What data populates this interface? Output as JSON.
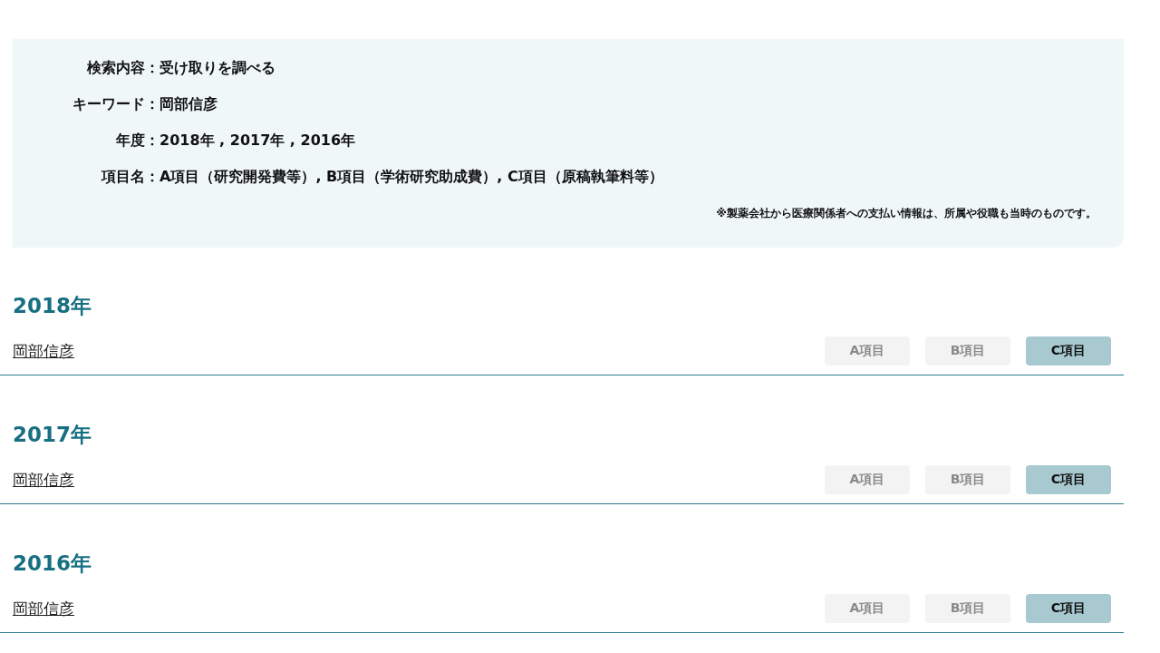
{
  "search_summary": {
    "rows": [
      {
        "label": "検索内容",
        "value": "受け取りを調べる"
      },
      {
        "label": "キーワード",
        "value": "岡部信彦"
      },
      {
        "label": "年度",
        "value": "2018年 , 2017年 , 2016年"
      },
      {
        "label": "項目名",
        "value": "A項目（研究開発費等）, B項目（学術研究助成費）, C項目（原稿執筆料等）"
      }
    ],
    "separator": "：",
    "note": "※製薬会社から医療関係者への支払い情報は、所属や役職も当時のものです。"
  },
  "results": [
    {
      "year": "2018年",
      "name": "岡部信彦",
      "items": [
        {
          "label": "A項目",
          "disabled": true
        },
        {
          "label": "B項目",
          "disabled": true
        },
        {
          "label": "C項目",
          "disabled": false
        }
      ]
    },
    {
      "year": "2017年",
      "name": "岡部信彦",
      "items": [
        {
          "label": "A項目",
          "disabled": true
        },
        {
          "label": "B項目",
          "disabled": true
        },
        {
          "label": "C項目",
          "disabled": false
        }
      ]
    },
    {
      "year": "2016年",
      "name": "岡部信彦",
      "items": [
        {
          "label": "A項目",
          "disabled": true
        },
        {
          "label": "B項目",
          "disabled": true
        },
        {
          "label": "C項目",
          "disabled": false
        }
      ]
    }
  ]
}
